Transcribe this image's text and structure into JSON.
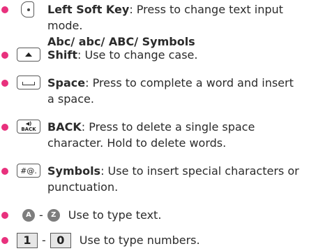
{
  "items": [
    {
      "icon": "left-soft-key-icon",
      "term": "Left Soft Key",
      "text": ": Press to change text input mode.",
      "line2": "Abc/ abc/ ABC/ Symbols"
    },
    {
      "icon": "shift-key-icon",
      "term": "Shift",
      "text": ": Use to change case."
    },
    {
      "icon": "space-key-icon",
      "term": "Space",
      "text": ": Press to complete a word and insert",
      "line2": "a space."
    },
    {
      "icon": "back-key-icon",
      "icon_text": "BACK",
      "term": "BACK",
      "text": ": Press to delete a single space",
      "line2": "character. Hold to delete words."
    },
    {
      "icon": "symbols-key-icon",
      "icon_text": "#@.",
      "term": "Symbols",
      "text": ": Use to insert special characters or",
      "line2": "punctuation."
    },
    {
      "icon_start": "A",
      "icon_end": "Z",
      "separator": "-",
      "text": "Use to type text."
    },
    {
      "icon_start": "1",
      "icon_end": "0",
      "separator": "-",
      "text": "Use to type numbers."
    }
  ],
  "colors": {
    "bullet": "#e8317d",
    "text": "#2b2b2b"
  }
}
